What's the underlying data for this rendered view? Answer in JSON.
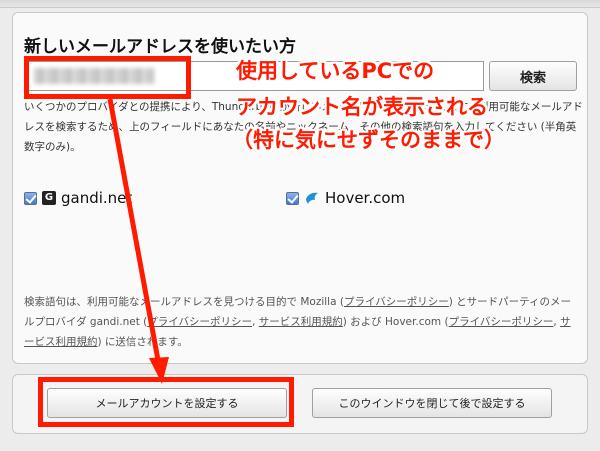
{
  "dialog": {
    "heading": "新しいメールアドレスを使いたい方",
    "search_button_label": "検索",
    "description": "いくつかのプロバイダとの提携により、Thunderbird が新しいメールアカウントを提供します。利用可能なメールアドレスを検索するため、上のフィールドにあなたの名前やニックネーム、その他の検索語句を入力してください (半角英数字のみ)。",
    "providers": [
      {
        "name": "gandi.net",
        "checked": true,
        "icon": "gandi-logo-icon"
      },
      {
        "name": "Hover.com",
        "checked": true,
        "icon": "hover-logo-icon"
      }
    ],
    "privacy_note": {
      "part1": "検索語句は、利用可能なメールアドレスを見つける目的で Mozilla (",
      "link1": "プライバシーポリシー",
      "part2": ") とサードパーティのメールプロバイダ gandi.net (",
      "link2": "プライバシーポリシー",
      "sep1": ", ",
      "link3": "サービス利用規約",
      "part3": ") および Hover.com (",
      "link4": "プライバシーポリシー",
      "sep2": ", ",
      "link5": "サービス利用規約",
      "part4": ") に送信されます。"
    },
    "setup_button_label": "メールアカウントを設定する",
    "close_button_label": "このウインドウを閉じて後で設定する"
  },
  "annotation": {
    "line1": "使用しているPCでの",
    "line2": "アカウント名が表示される",
    "line3": "（特に気にせずそのままで）",
    "color": "#ff1a00"
  }
}
